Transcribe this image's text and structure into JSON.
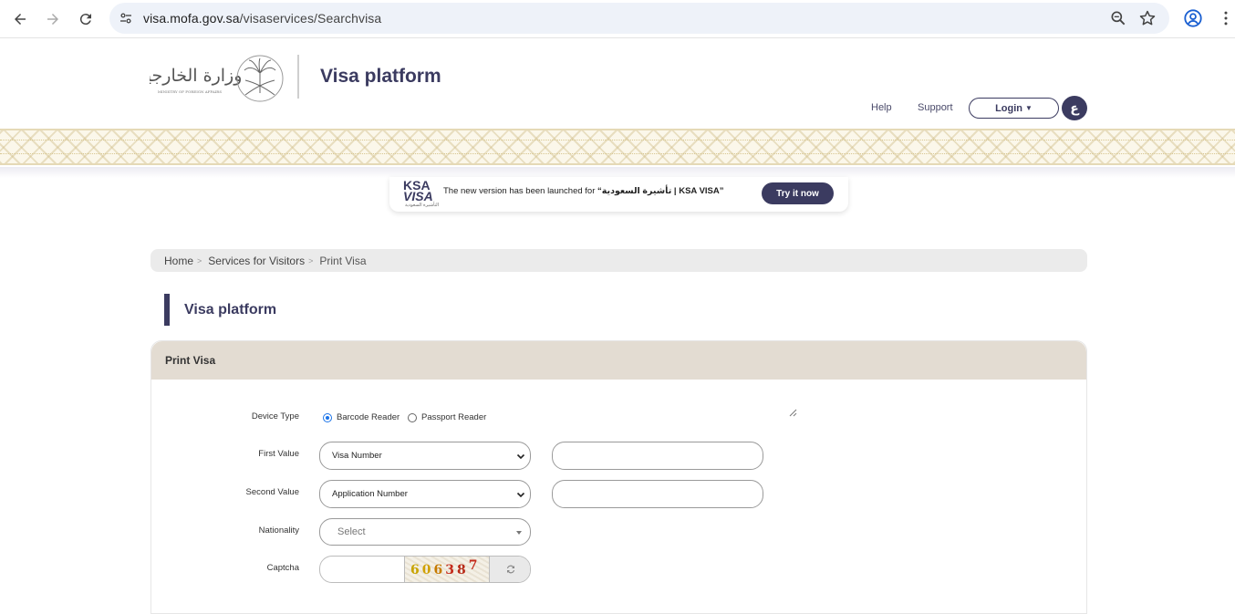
{
  "browser": {
    "url_domain": "visa.mofa.gov.sa",
    "url_path": "/visaservices/Searchvisa"
  },
  "header": {
    "site_title": "Visa platform",
    "logo_arabic": "وزارة الخارجية",
    "logo_english": "MINISTRY OF FOREIGN AFFAIRS",
    "links": {
      "help": "Help",
      "support": "Support"
    },
    "login_label": "Login",
    "lang_label": "ع"
  },
  "banner": {
    "logo_line1": "KSA",
    "logo_line2": "VISA",
    "logo_line3": "التأشيرة السعودية",
    "text_prefix": "The new version has been launched for",
    "text_highlight": "“تأشيرة السعودية | KSA VISA”",
    "button_label": "Try it now"
  },
  "breadcrumb": {
    "items": [
      "Home",
      "Services for Visitors",
      "Print Visa"
    ]
  },
  "page": {
    "heading": "Visa platform"
  },
  "form": {
    "card_title": "Print Visa",
    "device_type": {
      "label": "Device Type",
      "options": [
        "Barcode Reader",
        "Passport Reader"
      ],
      "selected": "Barcode Reader"
    },
    "first_value": {
      "label": "First Value",
      "selected": "Visa Number",
      "input_value": ""
    },
    "second_value": {
      "label": "Second Value",
      "selected": "Application Number",
      "input_value": ""
    },
    "nationality": {
      "label": "Nationality",
      "placeholder": "Select"
    },
    "captcha": {
      "label": "Captcha",
      "image_text": "606387",
      "input_value": ""
    }
  },
  "colors": {
    "brand": "#3b3b60",
    "card_header": "#e3dcd2",
    "pattern_gold": "#d1bf8c"
  }
}
